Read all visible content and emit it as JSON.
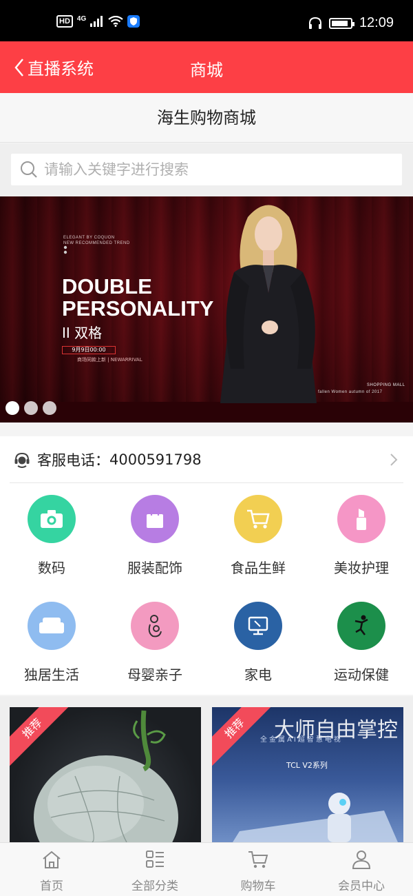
{
  "status_bar": {
    "hd": "HD",
    "network": "4G",
    "time": "12:09",
    "battery_level": 0.9,
    "shield_color": "#1a7cff"
  },
  "nav": {
    "back_label": "直播系统",
    "title": "商城",
    "color": "#fd3f45"
  },
  "shop": {
    "title": "海生购物商城"
  },
  "search": {
    "placeholder": "请输入关键字进行搜索"
  },
  "banner": {
    "brand_small": "ELEGANT BY COQUON",
    "brand_small2": "NEW RECOMMENDED TREND",
    "headline_line1": "DOUBLE",
    "headline_line2": "PERSONALITY",
    "subtitle": "II 双格",
    "date": "9月9日00:00",
    "tagline": "商场同款上新 | NEWARRIVAL",
    "shopping_mall": "SHOPPING MALL",
    "season": "fallen Women  autumn of 2017",
    "slide_count": 3,
    "active_slide": 1
  },
  "service": {
    "label": "客服电话：",
    "phone": "4000591798",
    "icon": "headset-icon"
  },
  "categories": [
    {
      "label": "数码",
      "icon": "camera-icon",
      "color": "#35d4a1"
    },
    {
      "label": "服装配饰",
      "icon": "shopping-bag-icon",
      "color": "#b77de3"
    },
    {
      "label": "食品生鲜",
      "icon": "cart-icon",
      "color": "#f2cf52"
    },
    {
      "label": "美妆护理",
      "icon": "lipstick-icon",
      "color": "#f596c6"
    },
    {
      "label": "独居生活",
      "icon": "sofa-icon",
      "color": "#8fbcf0"
    },
    {
      "label": "母婴亲子",
      "icon": "mother-baby-icon",
      "color": "#f39ac0"
    },
    {
      "label": "家电",
      "icon": "monitor-icon",
      "color": "#2a62a4"
    },
    {
      "label": "运动保健",
      "icon": "athlete-icon",
      "color": "#1c8f4b"
    }
  ],
  "products": [
    {
      "badge": "推荐",
      "image": "melon-image"
    },
    {
      "badge": "推荐",
      "image": "tv-image",
      "headline": "大师自由掌控",
      "sub": "全金属AI超智慧电视",
      "model": "TCL V2系列"
    }
  ],
  "tabs": [
    {
      "label": "首页",
      "icon": "home-icon"
    },
    {
      "label": "全部分类",
      "icon": "category-grid-icon"
    },
    {
      "label": "购物车",
      "icon": "cart-icon"
    },
    {
      "label": "会员中心",
      "icon": "user-icon"
    }
  ]
}
